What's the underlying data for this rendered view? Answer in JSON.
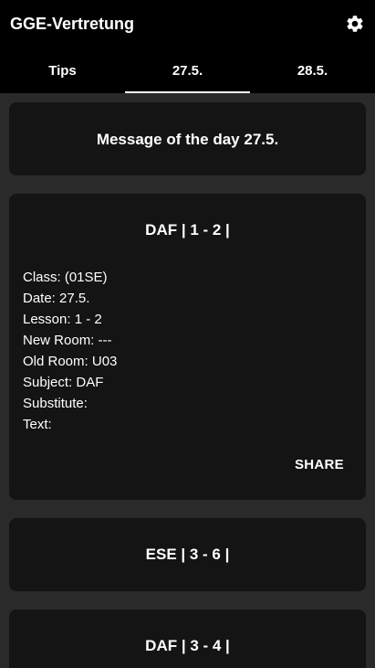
{
  "app": {
    "title": "GGE-Vertretung"
  },
  "tabs": [
    {
      "label": "Tips",
      "active": false
    },
    {
      "label": "27.5.",
      "active": true
    },
    {
      "label": "28.5.",
      "active": false
    }
  ],
  "motd": {
    "title": "Message of the day 27.5."
  },
  "entries": [
    {
      "title": "DAF | 1 - 2 |",
      "class_line": "Class: (01SE)",
      "date_line": "Date: 27.5.",
      "lesson_line": "Lesson: 1 - 2",
      "new_room_line": "New Room: ---",
      "old_room_line": "Old Room: U03",
      "subject_line": "Subject: DAF",
      "substitute_line": "Substitute:",
      "text_line": "Text:",
      "share_label": "SHARE"
    },
    {
      "title": "ESE | 3 - 6 |"
    },
    {
      "title": "DAF | 3 - 4 |"
    }
  ],
  "icons": {
    "settings": "gear-icon"
  },
  "colors": {
    "appbar": "#000000",
    "background": "#2a2a2a",
    "card": "#141414",
    "text": "#ffffff",
    "tab_indicator": "#ffffff"
  }
}
